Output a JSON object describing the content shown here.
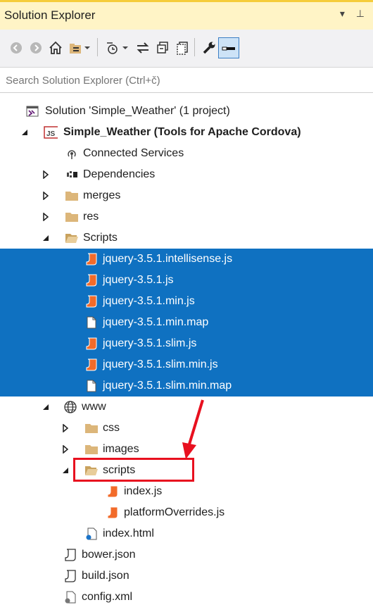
{
  "panel": {
    "title": "Solution Explorer",
    "title_icons": "▾ ⊥"
  },
  "search": {
    "placeholder": "Search Solution Explorer (Ctrl+č)"
  },
  "toolbar": {
    "icons": [
      "back-icon",
      "forward-icon",
      "home-icon",
      "switch-views-icon",
      "dropdown-icon",
      "pending-changes-icon",
      "dropdown-icon",
      "sync-icon",
      "collapse-all-icon",
      "show-all-files-icon",
      "properties-icon",
      "preview-icon"
    ]
  },
  "tree": {
    "solution": "Solution 'Simple_Weather' (1 project)",
    "project": "Simple_Weather (Tools for Apache Cordova)",
    "connected": "Connected Services",
    "dependencies": "Dependencies",
    "merges": "merges",
    "res": "res",
    "scripts_folder": "Scripts",
    "scripts_files": [
      "jquery-3.5.1.intellisense.js",
      "jquery-3.5.1.js",
      "jquery-3.5.1.min.js",
      "jquery-3.5.1.min.map",
      "jquery-3.5.1.slim.js",
      "jquery-3.5.1.slim.min.js",
      "jquery-3.5.1.slim.min.map"
    ],
    "www": "www",
    "css": "css",
    "images": "images",
    "scripts_sub": "scripts",
    "index_js": "index.js",
    "platform_js": "platformOverrides.js",
    "index_html": "index.html",
    "bower": "bower.json",
    "build": "build.json",
    "config": "config.xml"
  },
  "colors": {
    "selection": "#0f71c1",
    "highlight": "#e8101f",
    "folder": "#dcb67a",
    "js_icon": "#f26b2a"
  }
}
